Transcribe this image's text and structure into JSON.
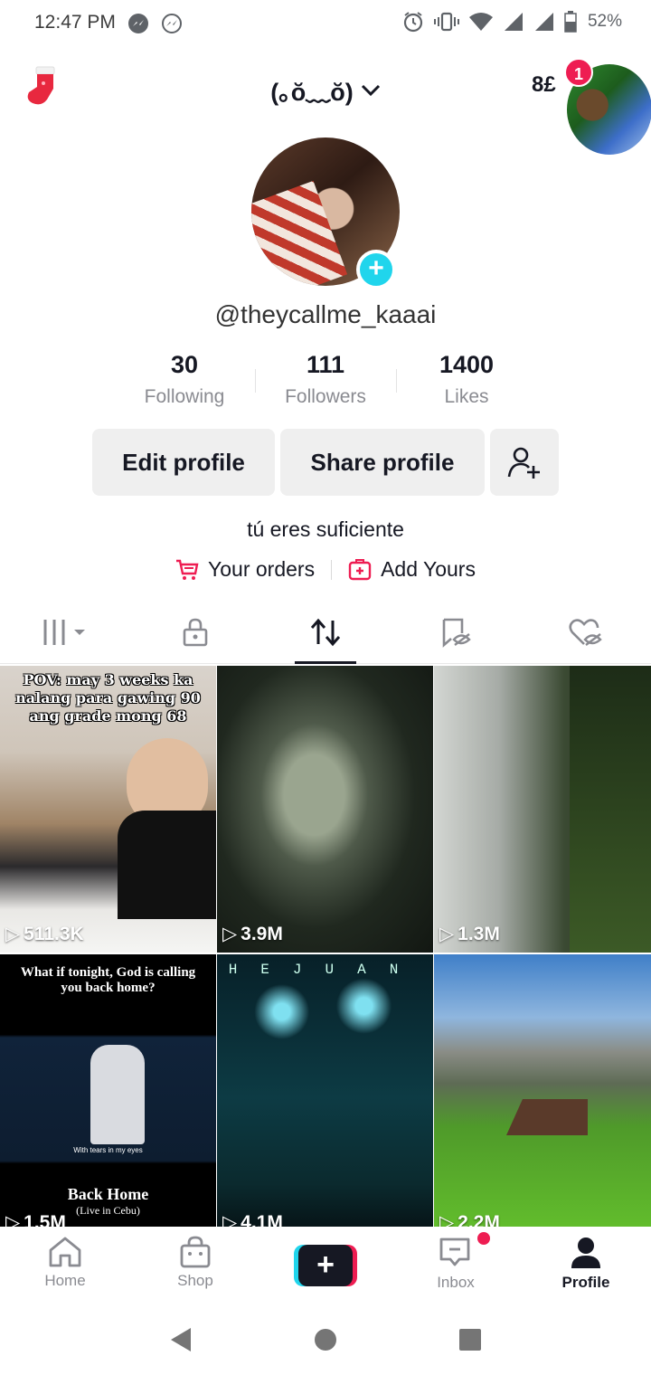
{
  "status_bar": {
    "time": "12:47 PM",
    "battery": "52%"
  },
  "header": {
    "title": "(｡ŏ﹏ŏ)",
    "gift_text": "8£",
    "story_badge": "1"
  },
  "profile": {
    "handle": "@theycallme_kaaai",
    "stats": [
      {
        "value": "30",
        "label": "Following"
      },
      {
        "value": "111",
        "label": "Followers"
      },
      {
        "value": "1400",
        "label": "Likes"
      }
    ],
    "edit_label": "Edit profile",
    "share_label": "Share profile",
    "bio": "tú eres suficiente",
    "orders_label": "Your orders",
    "add_yours_label": "Add Yours"
  },
  "tabs": [
    {
      "name": "videos",
      "icon": "grid-icon"
    },
    {
      "name": "private",
      "icon": "lock-icon"
    },
    {
      "name": "reposts",
      "icon": "repost-icon",
      "active": true
    },
    {
      "name": "favorites",
      "icon": "bookmark-hidden-icon"
    },
    {
      "name": "liked",
      "icon": "heart-hidden-icon"
    }
  ],
  "videos": [
    {
      "views": "511.3K",
      "caption": "POV: may 3 weeks ka nalang para gawing 90 ang grade mong 68"
    },
    {
      "views": "3.9M"
    },
    {
      "views": "1.3M"
    },
    {
      "views": "1.5M",
      "caption_top": "What if tonight, God is calling you back home?",
      "caption_small": "With tears in my eyes",
      "caption_bottom": "Back Home",
      "caption_bottom_sub": "(Live in Cebu)"
    },
    {
      "views": "4.1M",
      "caption": "HEJUAN"
    },
    {
      "views": "2.2M"
    }
  ],
  "bottom_nav": [
    {
      "label": "Home"
    },
    {
      "label": "Shop"
    },
    {
      "label": ""
    },
    {
      "label": "Inbox"
    },
    {
      "label": "Profile",
      "active": true
    }
  ],
  "colors": {
    "accent": "#ee1d52",
    "cyan": "#20d5ec",
    "text": "#161823"
  }
}
